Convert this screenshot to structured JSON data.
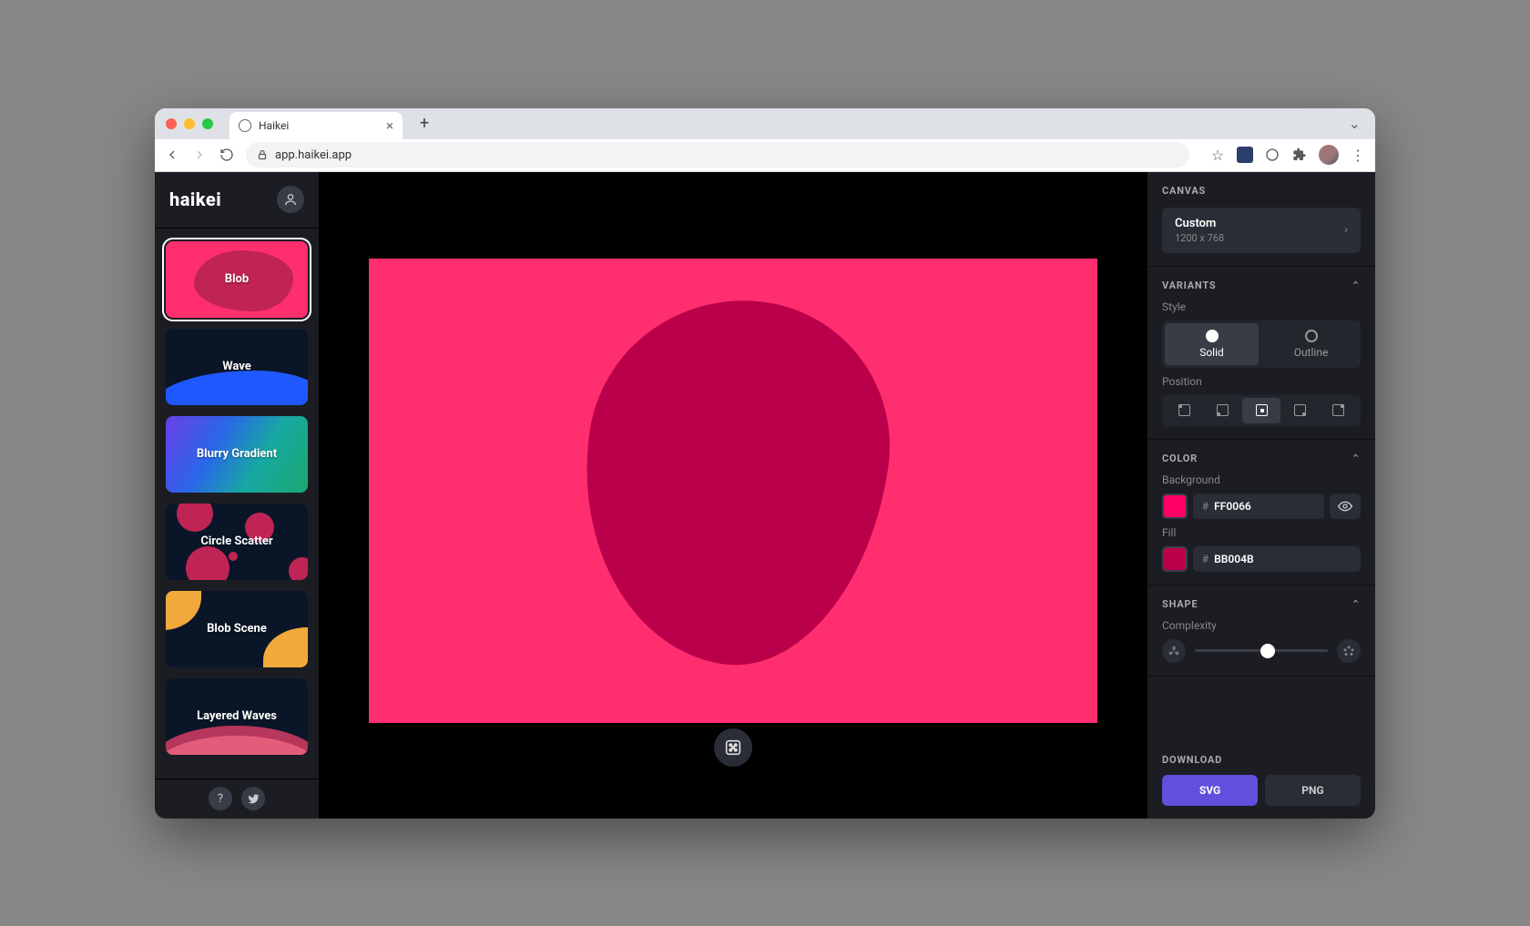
{
  "browser": {
    "tab_title": "Haikei",
    "url": "app.haikei.app"
  },
  "app": {
    "logo": "haikei"
  },
  "generators": [
    {
      "key": "blob",
      "label": "Blob",
      "active": true
    },
    {
      "key": "wave",
      "label": "Wave"
    },
    {
      "key": "blurry-gradient",
      "label": "Blurry Gradient"
    },
    {
      "key": "circle-scatter",
      "label": "Circle Scatter"
    },
    {
      "key": "blob-scene",
      "label": "Blob Scene"
    },
    {
      "key": "layered-waves",
      "label": "Layered Waves"
    }
  ],
  "panel": {
    "canvas": {
      "title": "CANVAS",
      "preset": "Custom",
      "dims": "1200 x 768"
    },
    "variants": {
      "title": "VARIANTS",
      "style_label": "Style",
      "styles": {
        "solid": "Solid",
        "outline": "Outline"
      },
      "position_label": "Position"
    },
    "color": {
      "title": "COLOR",
      "background_label": "Background",
      "background_hex": "FF0066",
      "fill_label": "Fill",
      "fill_hex": "BB004B"
    },
    "shape": {
      "title": "SHAPE",
      "complexity_label": "Complexity"
    },
    "download": {
      "title": "DOWNLOAD",
      "svg": "SVG",
      "png": "PNG"
    }
  },
  "colors": {
    "bg": "#ff2e6e",
    "blob": "#bb004b",
    "accent": "#6050dc"
  }
}
